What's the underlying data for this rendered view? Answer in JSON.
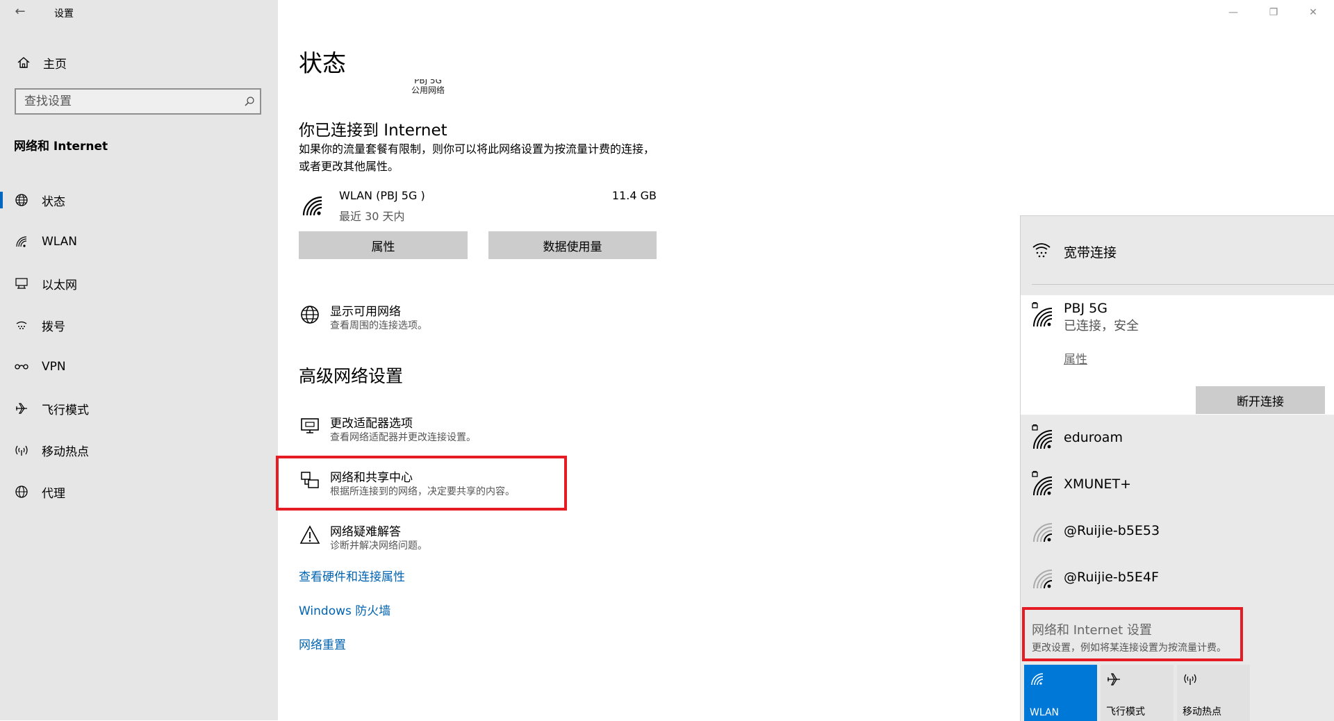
{
  "window": {
    "title": "设置"
  },
  "sidebar": {
    "home": "主页",
    "search_placeholder": "查找设置",
    "section": "网络和 Internet",
    "items": [
      {
        "label": "状态",
        "icon": "globe-status-icon"
      },
      {
        "label": "WLAN",
        "icon": "wifi-icon"
      },
      {
        "label": "以太网",
        "icon": "ethernet-icon"
      },
      {
        "label": "拨号",
        "icon": "dialup-icon"
      },
      {
        "label": "VPN",
        "icon": "vpn-icon"
      },
      {
        "label": "飞行模式",
        "icon": "airplane-icon"
      },
      {
        "label": "移动热点",
        "icon": "hotspot-icon"
      },
      {
        "label": "代理",
        "icon": "globe-icon"
      }
    ]
  },
  "main": {
    "title": "状态",
    "network_name": "PBJ 5G",
    "network_type": "公用网络",
    "connected_heading": "你已连接到 Internet",
    "connected_desc": "如果你的流量套餐有限制，则你可以将此网络设置为按流量计费的连接，或者更改其他属性。",
    "usage": {
      "name": "WLAN (PBJ 5G )",
      "period": "最近 30 天内",
      "amount": "11.4 GB"
    },
    "btn_properties": "属性",
    "btn_data_usage": "数据使用量",
    "show_networks": {
      "title": "显示可用网络",
      "sub": "查看周围的连接选项。"
    },
    "advanced_heading": "高级网络设置",
    "adapter": {
      "title": "更改适配器选项",
      "sub": "查看网络适配器并更改连接设置。"
    },
    "sharing": {
      "title": "网络和共享中心",
      "sub": "根据所连接到的网络，决定要共享的内容。"
    },
    "troubleshoot": {
      "title": "网络疑难解答",
      "sub": "诊断并解决网络问题。"
    },
    "links": [
      "查看硬件和连接属性",
      "Windows 防火墙",
      "网络重置"
    ]
  },
  "flyout": {
    "broadband": "宽带连接",
    "connected": {
      "name": "PBJ 5G",
      "status": "已连接，安全",
      "properties": "属性",
      "disconnect": "断开连接"
    },
    "networks": [
      "eduroam",
      "XMUNET+",
      "@Ruijie-b5E53",
      "@Ruijie-b5E4F"
    ],
    "settings_title": "网络和 Internet 设置",
    "settings_sub": "更改设置，例如将某连接设置为按流量计费。",
    "quick_actions": [
      "WLAN",
      "飞行模式",
      "移动热点"
    ]
  },
  "colors": {
    "accent": "#0078d7",
    "highlight": "#e61c24",
    "link": "#0063b1"
  }
}
